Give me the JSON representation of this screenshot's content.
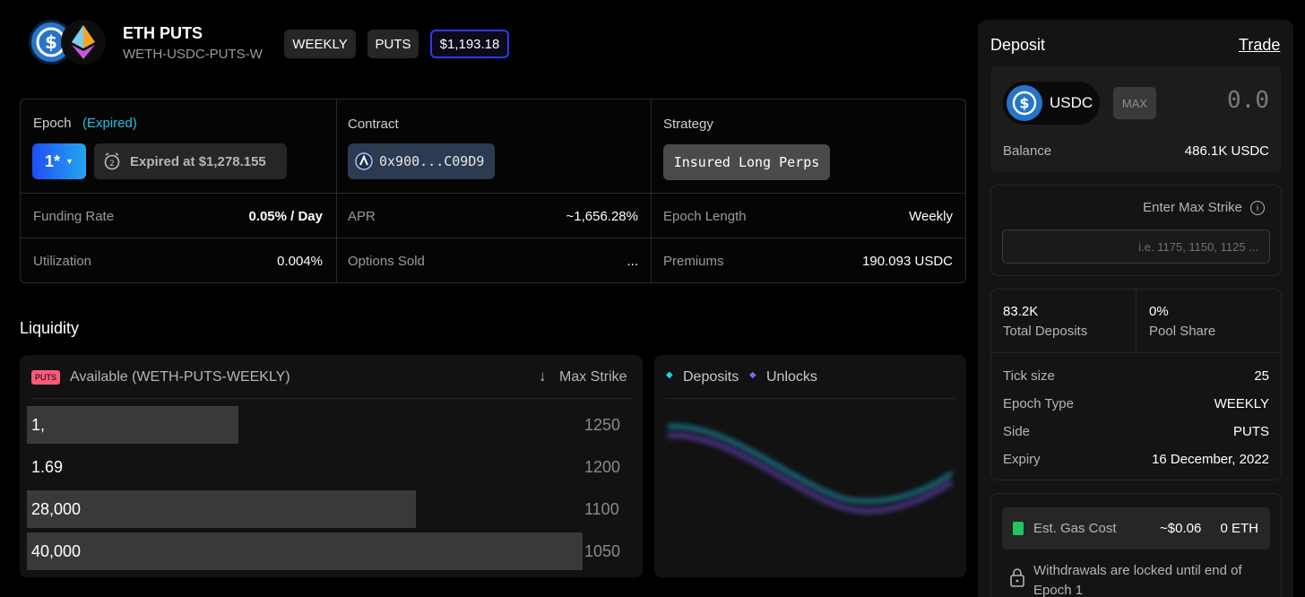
{
  "header": {
    "title": "ETH PUTS",
    "subtitle": "WETH-USDC-PUTS-W",
    "tags": [
      "WEEKLY",
      "PUTS"
    ],
    "price": "$1,193.18"
  },
  "info": {
    "epoch_label": "Epoch",
    "epoch_status": "(Expired)",
    "epoch_select": "1*",
    "expired_text": "Expired at $1,278.155",
    "contract_label": "Contract",
    "contract_address": "0x900...C09D9",
    "strategy_label": "Strategy",
    "strategy_value": "Insured Long Perps",
    "stats": [
      {
        "label": "Funding Rate",
        "value": "0.05% / Day"
      },
      {
        "label": "APR",
        "value": "~1,656.28%"
      },
      {
        "label": "Epoch Length",
        "value": "Weekly"
      },
      {
        "label": "Utilization",
        "value": "0.004%"
      },
      {
        "label": "Options Sold",
        "value": "..."
      },
      {
        "label": "Premiums",
        "value": "190.093 USDC"
      }
    ]
  },
  "liquidity": {
    "title": "Liquidity",
    "badge": "PUTS",
    "available_label": "Available (WETH-PUTS-WEEKLY)",
    "sort_label": "Max Strike",
    "rows": [
      {
        "amount": "1,",
        "strike": "1250",
        "fill": 0.38
      },
      {
        "amount": "1.69",
        "strike": "1200",
        "fill": 0
      },
      {
        "amount": "28,000",
        "strike": "1100",
        "fill": 0.7
      },
      {
        "amount": "40,000",
        "strike": "1050",
        "fill": 1.0
      }
    ],
    "legend": [
      "Deposits",
      "Unlocks"
    ]
  },
  "deposit": {
    "title": "Deposit",
    "trade_link": "Trade",
    "token": "USDC",
    "max_label": "MAX",
    "amount": "0.0",
    "balance_label": "Balance",
    "balance_value": "486.1K USDC",
    "max_strike_label": "Enter Max Strike",
    "max_strike_placeholder": "i.e. 1175, 1150, 1125 ...",
    "total_deposits_value": "83.2K",
    "total_deposits_label": "Total Deposits",
    "pool_share_value": "0%",
    "pool_share_label": "Pool Share",
    "details": [
      {
        "label": "Tick size",
        "value": "25"
      },
      {
        "label": "Epoch Type",
        "value": "WEEKLY"
      },
      {
        "label": "Side",
        "value": "PUTS"
      },
      {
        "label": "Expiry",
        "value": "16 December, 2022"
      }
    ],
    "gas_label": "Est. Gas Cost",
    "gas_value": "~$0.06",
    "gas_eth": "0 ETH",
    "withdraw_note": "Withdrawals are locked until end of Epoch 1"
  },
  "colors": {
    "accent": "#2d7cf6",
    "epoch_status": "#22c1e6",
    "deposits": "#22d3ee",
    "unlocks": "#8b5cf6",
    "puts_badge": "#ff5a7a"
  }
}
